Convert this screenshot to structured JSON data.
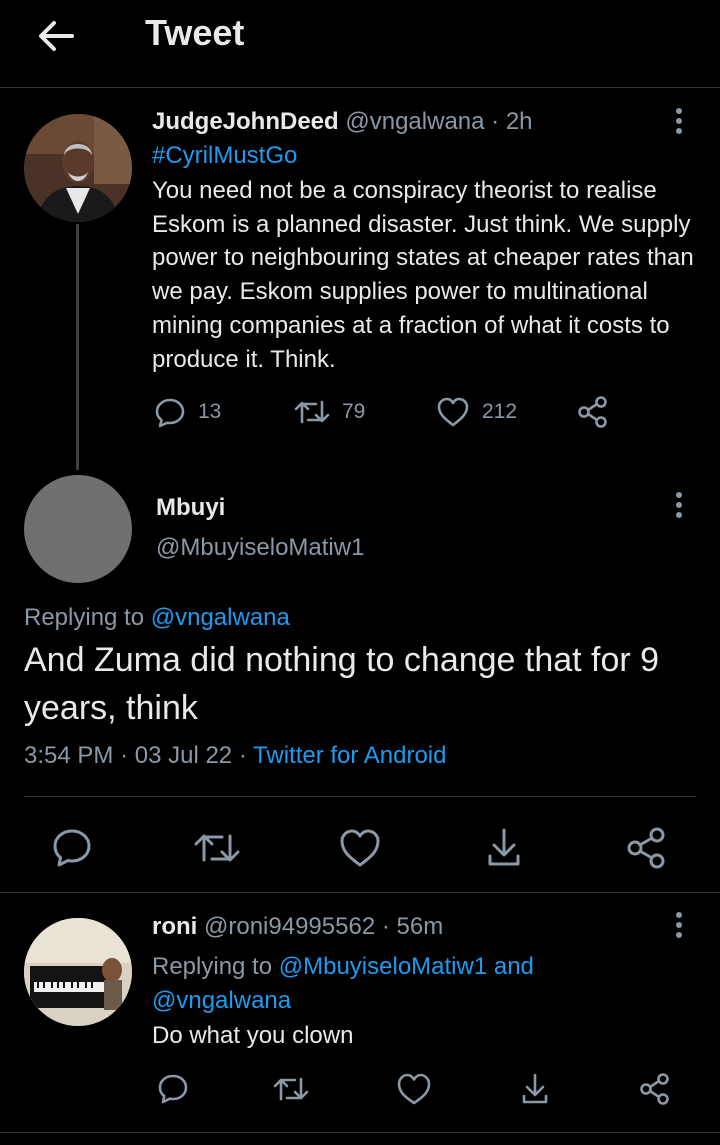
{
  "header": {
    "title": "Tweet",
    "back_icon": "arrow-left-icon"
  },
  "parent_tweet": {
    "name": "JudgeJohnDeed",
    "handle": "@vngalwana",
    "time": "· 2h",
    "hashtag": "#CyrilMustGo",
    "text": "You need not be a conspiracy theorist to realise Eskom is a planned disaster. Just think. We supply power to neighbouring states at cheaper rates than we pay. Eskom supplies power to multinational mining companies at a fraction of what it costs to produce it. Think.",
    "replies": "13",
    "retweets": "79",
    "likes": "212"
  },
  "main_tweet": {
    "name": "Mbuyi",
    "handle": "@MbuyiseloMatiw1",
    "replying_prefix": "Replying to",
    "replying_to": "@vngalwana",
    "text": "And Zuma did nothing to change that for 9 years, think",
    "time": "3:54 PM",
    "date": "03 Jul 22",
    "source": "Twitter for Android",
    "sep": "·"
  },
  "reply_tweet": {
    "name": "roni",
    "handle": "@roni94995562",
    "time": "· 56m",
    "replying_prefix": "Replying to",
    "replying_to_1": "@MbuyiseloMatiw1",
    "replying_and": "and",
    "replying_to_2": "@vngalwana",
    "text": "Do what you clown"
  },
  "colors": {
    "background": "#000000",
    "text": "#e7e9ea",
    "muted": "#8b98a5",
    "link": "#1d9bf0",
    "divider": "#2f3336"
  }
}
